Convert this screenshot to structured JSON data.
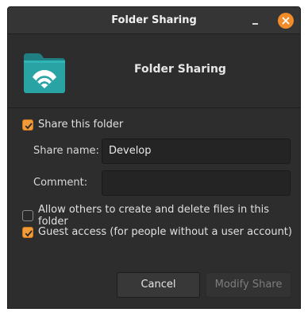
{
  "window": {
    "title": "Folder Sharing"
  },
  "header": {
    "title": "Folder Sharing",
    "icon": "shared-folder-icon"
  },
  "options": {
    "share_this_folder": {
      "label": "Share this folder",
      "checked": true
    },
    "allow_others": {
      "label": "Allow others to create and delete files in this folder",
      "checked": false
    },
    "guest_access": {
      "label": "Guest access (for people without a user account)",
      "checked": true
    }
  },
  "fields": {
    "share_name": {
      "label": "Share name:",
      "value": "Develop"
    },
    "comment": {
      "label": "Comment:",
      "value": ""
    }
  },
  "buttons": {
    "cancel": "Cancel",
    "modify": "Modify Share"
  },
  "colors": {
    "accent": "#f29b3a",
    "close_button": "#f08c2a",
    "folder": "#2a9d9f"
  }
}
